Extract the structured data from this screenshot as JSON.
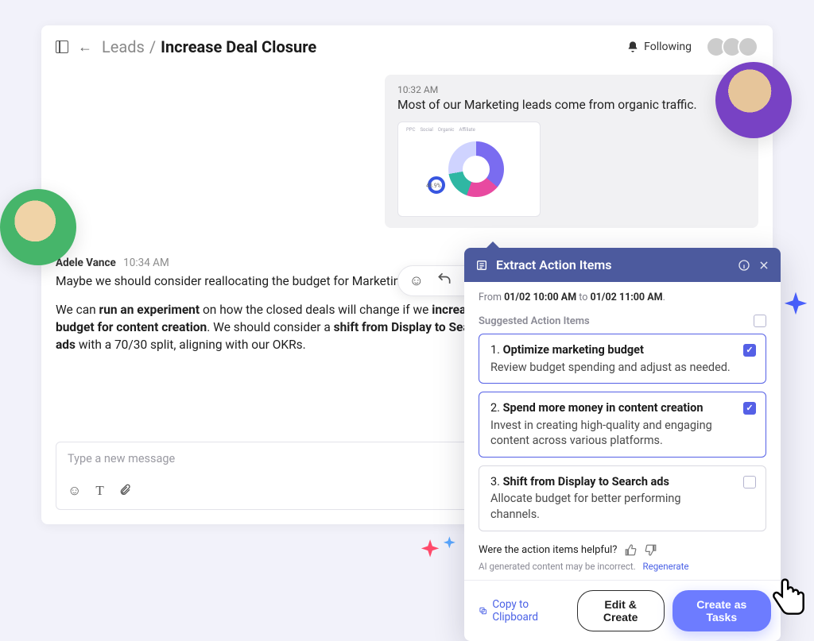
{
  "header": {
    "breadcrumb_parent": "Leads",
    "breadcrumb_sep": "/",
    "breadcrumb_current": "Increase Deal Closure",
    "following_label": "Following"
  },
  "incoming": {
    "time": "10:32 AM",
    "text": "Most of our Marketing leads come from organic traffic.",
    "donut_label": "48.9%",
    "legend": [
      "PPC",
      "Social",
      "Organic",
      "Affiliate"
    ]
  },
  "outgoing": {
    "author": "Adele Vance",
    "time": "10:34 AM",
    "p1_pre": "Maybe we should consider reallocating the budget for Marketing initiatives.",
    "p2_a": "We can ",
    "p2_b_bold": "run an experiment",
    "p2_c": " on how the closed deals will change if we ",
    "p2_d_bold": "increase the budget for content creation",
    "p2_e": ". We should consider a ",
    "p2_f_bold": "shift from Display to Search ads",
    "p2_g": " with a 70/30 split, aligning with our OKRs."
  },
  "composer": {
    "placeholder": "Type a new message"
  },
  "popover": {
    "title": "Extract Action Items",
    "range_pre": "From ",
    "range_from": "01/02 10:00 AM",
    "range_mid": " to ",
    "range_to": "01/02 11:00 AM",
    "range_post": ".",
    "suggested_label": "Suggested Action Items",
    "items": [
      {
        "num": "1.",
        "title": "Optimize marketing budget",
        "desc": "Review budget spending and adjust as needed.",
        "checked": true
      },
      {
        "num": "2.",
        "title": "Spend more money in content creation",
        "desc": "Invest in creating high-quality and engaging content across various platforms.",
        "checked": true
      },
      {
        "num": "3.",
        "title": "Shift from Display to Search ads",
        "desc": "Allocate budget for better performing channels.",
        "checked": false
      }
    ],
    "feedback_q": "Were the action items helpful?",
    "disclaimer": "AI generated content may be incorrect.",
    "regenerate": "Regenerate",
    "copy_label": "Copy to Clipboard",
    "edit_label": "Edit & Create",
    "create_label": "Create as Tasks"
  },
  "chart_data": {
    "type": "pie",
    "title": "",
    "series": [
      {
        "name": "Organic",
        "value": 48.9
      },
      {
        "name": "PPC",
        "value": 18
      },
      {
        "name": "Social",
        "value": 18
      },
      {
        "name": "Affiliate",
        "value": 15.1
      }
    ],
    "highlight_label": "48.9%",
    "legend_position": "top"
  }
}
